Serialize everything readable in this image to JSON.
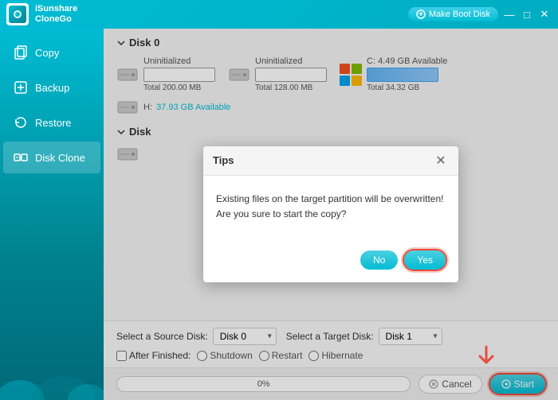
{
  "app": {
    "name_line1": "iSunshare",
    "name_line2": "CloneGo",
    "make_boot_label": "Make Boot Disk",
    "win_minimize": "—",
    "win_restore": "□",
    "win_close": "✕"
  },
  "sidebar": {
    "items": [
      {
        "id": "copy",
        "label": "Copy",
        "active": false
      },
      {
        "id": "backup",
        "label": "Backup",
        "active": false
      },
      {
        "id": "restore",
        "label": "Restore",
        "active": false
      },
      {
        "id": "disk-clone",
        "label": "Disk Clone",
        "active": true
      }
    ]
  },
  "disk0": {
    "header": "Disk 0",
    "partitions": [
      {
        "label": "Uninitialized",
        "size": "Total 200.00 MB",
        "type": "empty"
      },
      {
        "label": "Uninitialized",
        "size": "Total 128.00 MB",
        "type": "empty"
      },
      {
        "label": "C:",
        "avail": "4.49 GB Available",
        "size": "Total 34.32 GB",
        "type": "windows"
      }
    ],
    "h_drive": {
      "label": "H:",
      "avail": "37.93 GB Available"
    }
  },
  "disk1": {
    "header": "Disk"
  },
  "bottom": {
    "source_label": "Select a Source Disk:",
    "source_value": "Disk 0",
    "target_label": "Select a Target Disk:",
    "target_value": "Disk 1",
    "after_finished_label": "After Finished:",
    "shutdown_label": "Shutdown",
    "restart_label": "Restart",
    "hibernate_label": "Hibernate"
  },
  "progress": {
    "percent": "0%",
    "cancel_label": "Cancel",
    "start_label": "Start"
  },
  "dialog": {
    "title": "Tips",
    "message": "Existing files on the target partition will be overwritten! Are you sure to start the copy?",
    "no_label": "No",
    "yes_label": "Yes"
  }
}
